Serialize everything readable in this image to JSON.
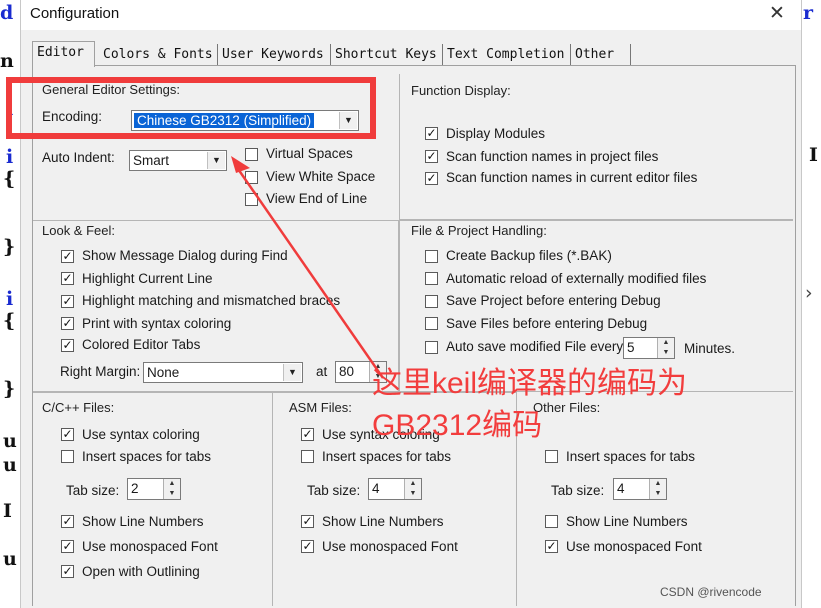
{
  "dialog": {
    "title": "Configuration",
    "close_glyph": "✕"
  },
  "tabs": [
    {
      "label": "Editor",
      "active": true
    },
    {
      "label": "Colors & Fonts",
      "active": false
    },
    {
      "label": "User Keywords",
      "active": false
    },
    {
      "label": "Shortcut Keys",
      "active": false
    },
    {
      "label": "Text Completion",
      "active": false
    },
    {
      "label": "Other",
      "active": false
    }
  ],
  "general": {
    "title": "General Editor Settings:",
    "encoding_label": "Encoding:",
    "encoding_value": "Chinese GB2312 (Simplified)",
    "auto_indent_label": "Auto Indent:",
    "auto_indent_value": "Smart",
    "virtual_spaces": {
      "label": "Virtual Spaces",
      "checked": false
    },
    "view_white_space": {
      "label": "View White Space",
      "checked": false
    },
    "view_end_of_line": {
      "label": "View End of Line",
      "checked": false
    }
  },
  "function_display": {
    "title": "Function Display:",
    "display_modules": {
      "label": "Display Modules",
      "checked": true
    },
    "scan_project": {
      "label": "Scan function names in project files",
      "checked": true
    },
    "scan_editor": {
      "label": "Scan function names in current editor files",
      "checked": true
    }
  },
  "look_feel": {
    "title": "Look & Feel:",
    "show_message_dialog": {
      "label": "Show Message Dialog during Find",
      "checked": true
    },
    "highlight_current_line": {
      "label": "Highlight Current Line",
      "checked": true
    },
    "highlight_braces": {
      "label": "Highlight matching and mismatched braces",
      "checked": true
    },
    "print_syntax": {
      "label": "Print with syntax coloring",
      "checked": true
    },
    "colored_tabs": {
      "label": "Colored Editor Tabs",
      "checked": true
    },
    "right_margin_label": "Right Margin:",
    "right_margin_value": "None",
    "at_label": "at",
    "at_value": "80"
  },
  "file_project": {
    "title": "File & Project Handling:",
    "create_backup": {
      "label": "Create Backup files (*.BAK)",
      "checked": false
    },
    "auto_reload": {
      "label": "Automatic reload of externally modified files",
      "checked": false
    },
    "save_project": {
      "label": "Save Project before entering Debug",
      "checked": false
    },
    "save_files": {
      "label": "Save Files before entering Debug",
      "checked": false
    },
    "auto_save": {
      "label": "Auto save modified File every",
      "checked": false
    },
    "auto_save_value": "5",
    "minutes_label": "Minutes."
  },
  "cpp_files": {
    "title": "C/C++ Files:",
    "use_syntax": {
      "label": "Use syntax coloring",
      "checked": true
    },
    "insert_spaces": {
      "label": "Insert spaces for tabs",
      "checked": false
    },
    "tab_size_label": "Tab size:",
    "tab_size_value": "2",
    "show_line_numbers": {
      "label": "Show Line Numbers",
      "checked": true
    },
    "monospaced": {
      "label": "Use monospaced Font",
      "checked": true
    },
    "outlining": {
      "label": "Open with Outlining",
      "checked": true
    }
  },
  "asm_files": {
    "title": "ASM Files:",
    "use_syntax": {
      "label": "Use syntax coloring",
      "checked": true
    },
    "insert_spaces": {
      "label": "Insert spaces for tabs",
      "checked": false
    },
    "tab_size_label": "Tab size:",
    "tab_size_value": "4",
    "show_line_numbers": {
      "label": "Show Line Numbers",
      "checked": true
    },
    "monospaced": {
      "label": "Use monospaced Font",
      "checked": true
    }
  },
  "other_files": {
    "title": "Other Files:",
    "insert_spaces": {
      "label": "Insert spaces for tabs",
      "checked": false
    },
    "tab_size_label": "Tab size:",
    "tab_size_value": "4",
    "show_line_numbers": {
      "label": "Show Line Numbers",
      "checked": false
    },
    "monospaced": {
      "label": "Use monospaced Font",
      "checked": true
    }
  },
  "annotation": {
    "line1": "这里keil编译器的编码为",
    "line2": "GB2312编码",
    "color": "#f23d3d"
  },
  "watermark": "CSDN @rivencode",
  "background_code": {
    "left": [
      "d",
      "n",
      "i",
      "i",
      "{",
      "}",
      "i",
      "{",
      "}",
      "u",
      "u",
      "I",
      "u"
    ],
    "right_top": "r",
    "right_mid": "I",
    "right_chevron": "›"
  }
}
